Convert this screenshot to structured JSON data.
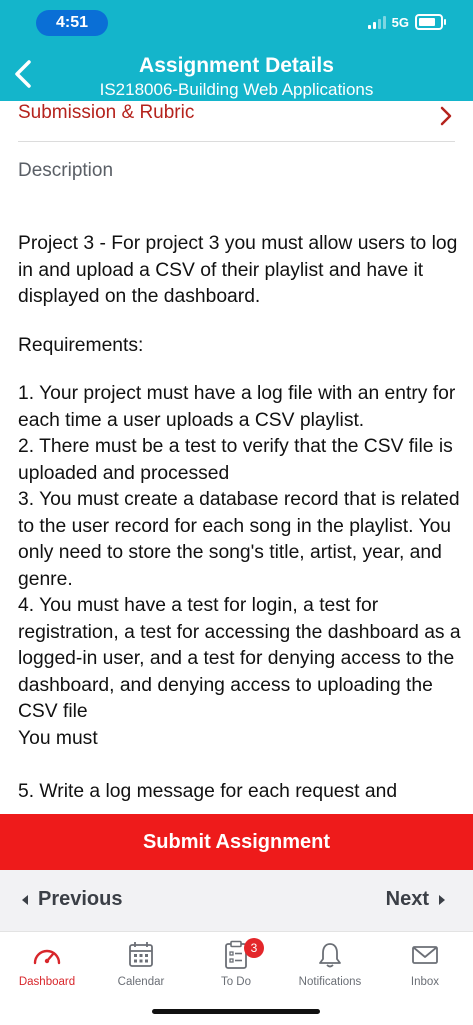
{
  "status": {
    "time": "4:51",
    "network": "5G"
  },
  "header": {
    "title": "Assignment Details",
    "subtitle": "IS218006-Building Web Applications"
  },
  "section": {
    "label": "Submission & Rubric"
  },
  "description": {
    "heading": "Description",
    "intro": "Project 3 - For project 3 you must allow users to log in and upload a CSV of their playlist and have it displayed on the dashboard.",
    "requirements_label": "Requirements:",
    "items": "1. Your project must have a log file with an entry for each time a user uploads a CSV playlist.\n2. There must be a test to verify that the CSV file is uploaded and processed\n3. You must create a database record that is related to the user record for each song in the playlist.  You only need to store the song's title, artist, year, and genre.\n4. You must have a test for login, a test for registration, a test for accessing the dashboard as a logged-in user, and a test for denying access to the dashboard, and denying access to uploading the CSV file\nYou must\n\n5. Write a log message for each request and"
  },
  "actions": {
    "submit": "Submit Assignment",
    "previous": "Previous",
    "next": "Next"
  },
  "tabs": [
    {
      "label": "Dashboard",
      "icon": "dashboard-icon",
      "active": true
    },
    {
      "label": "Calendar",
      "icon": "calendar-icon"
    },
    {
      "label": "To Do",
      "icon": "todo-icon",
      "badge": "3"
    },
    {
      "label": "Notifications",
      "icon": "bell-icon"
    },
    {
      "label": "Inbox",
      "icon": "inbox-icon"
    }
  ],
  "colors": {
    "header": "#14b5cb",
    "accent": "#ee1b1b",
    "link": "#b5231d"
  }
}
